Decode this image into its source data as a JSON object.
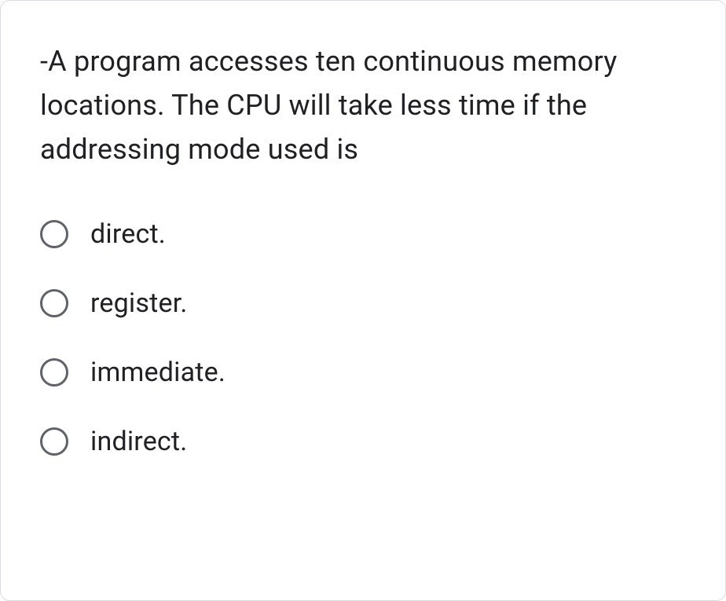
{
  "question": "-A program accesses ten continuous memory locations. The CPU will take less time if the addressing mode used is",
  "options": [
    {
      "label": "direct."
    },
    {
      "label": "register."
    },
    {
      "label": "immediate."
    },
    {
      "label": "indirect."
    }
  ]
}
